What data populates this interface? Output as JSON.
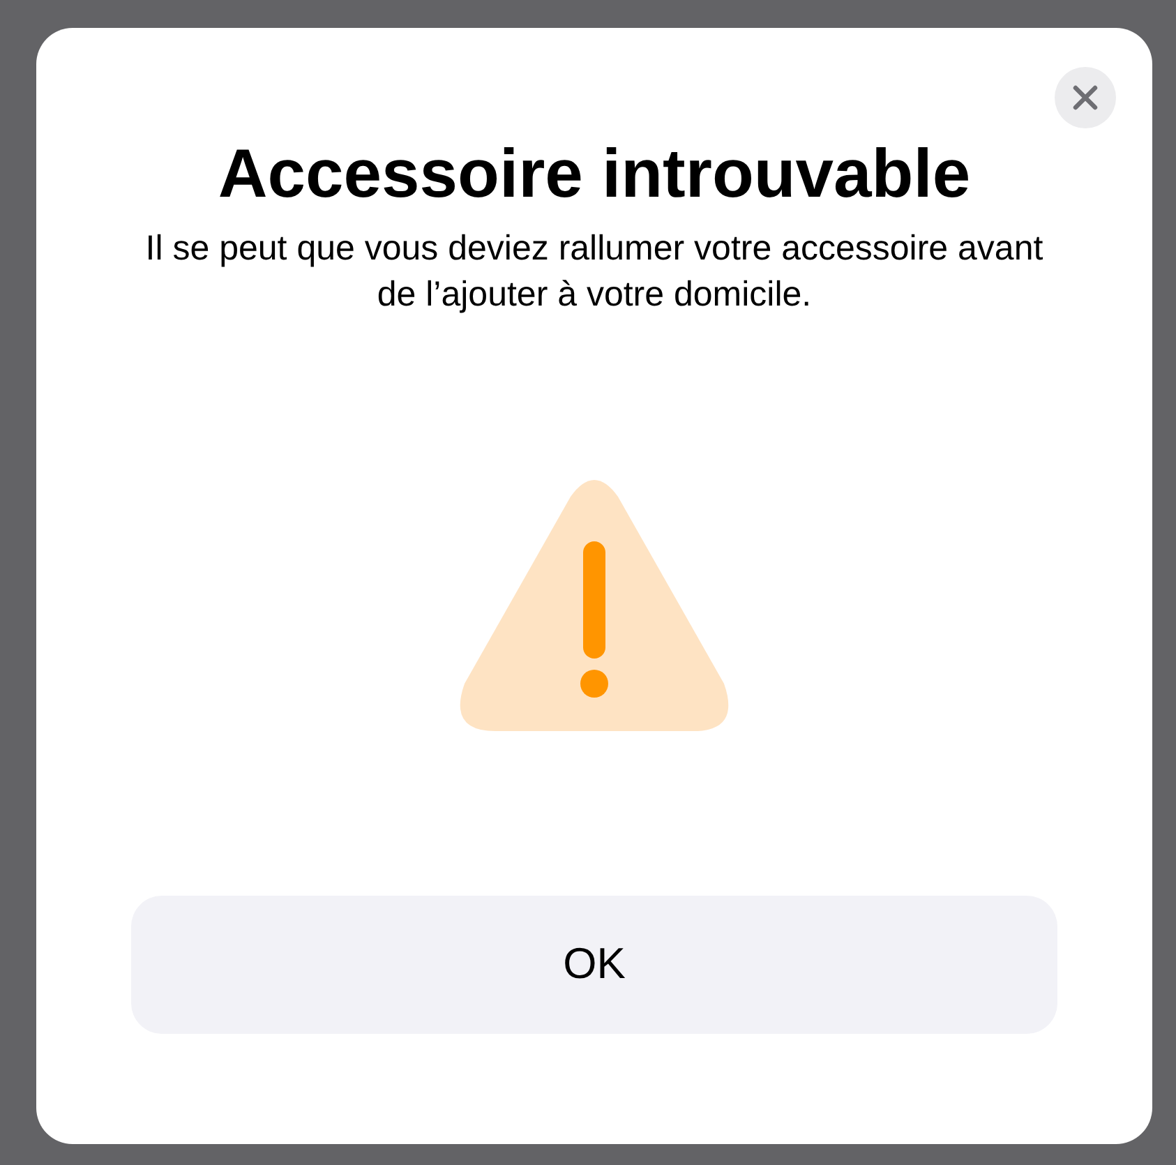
{
  "dialog": {
    "title": "Accessoire introuvable",
    "message": "Il se peut que vous deviez rallumer votre accessoire avant de l’ajouter à votre domicile.",
    "buttons": [
      "OK"
    ]
  }
}
